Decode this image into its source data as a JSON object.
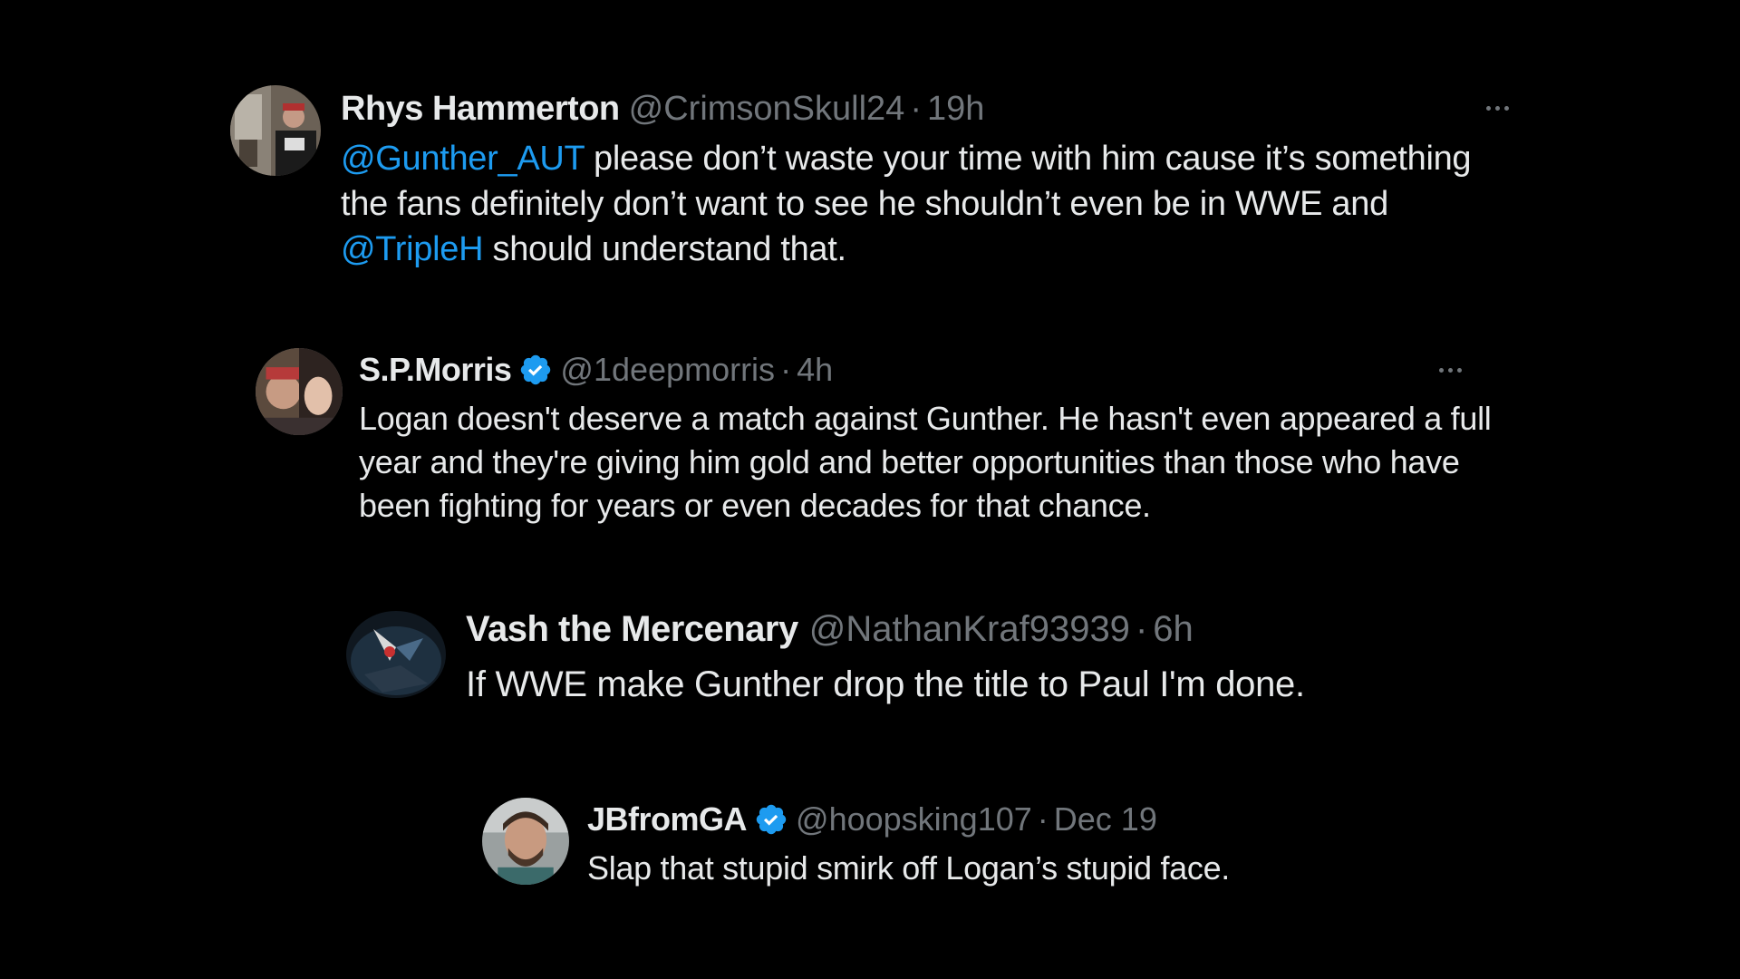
{
  "tweets": [
    {
      "name": "Rhys Hammerton",
      "handle": "@CrimsonSkull24",
      "separator": "·",
      "time": "19h",
      "verified": false,
      "body": {
        "mention1": "@Gunther_AUT",
        "text1": " please don’t waste your time with him cause it’s something the fans definitely don’t want to see he shouldn’t even be in WWE and ",
        "mention2": "@TripleH",
        "text2": " should understand that."
      }
    },
    {
      "name": "S.P.Morris",
      "handle": "@1deepmorris",
      "separator": "·",
      "time": "4h",
      "verified": true,
      "body": {
        "text": "Logan doesn't deserve a match against Gunther. He hasn't even appeared a full year and they're giving him gold and better opportunities than those who have been fighting for years or even decades for that chance."
      }
    },
    {
      "name": "Vash the Mercenary",
      "handle": "@NathanKraf93939",
      "separator": "·",
      "time": "6h",
      "verified": false,
      "body": {
        "text": "If WWE make Gunther drop the title to Paul I'm done."
      }
    },
    {
      "name": "JBfromGA",
      "handle": "@hoopsking107",
      "separator": "·",
      "time": "Dec 19",
      "verified": true,
      "body": {
        "text": "Slap that stupid smirk off Logan’s stupid face."
      }
    }
  ],
  "colors": {
    "background": "#000000",
    "text": "#e7e9ea",
    "muted": "#71767b",
    "mention": "#1d9bf0",
    "verified": "#1d9bf0"
  },
  "icons": {
    "verified": "verified-badge-icon",
    "more": "more-options-icon"
  }
}
